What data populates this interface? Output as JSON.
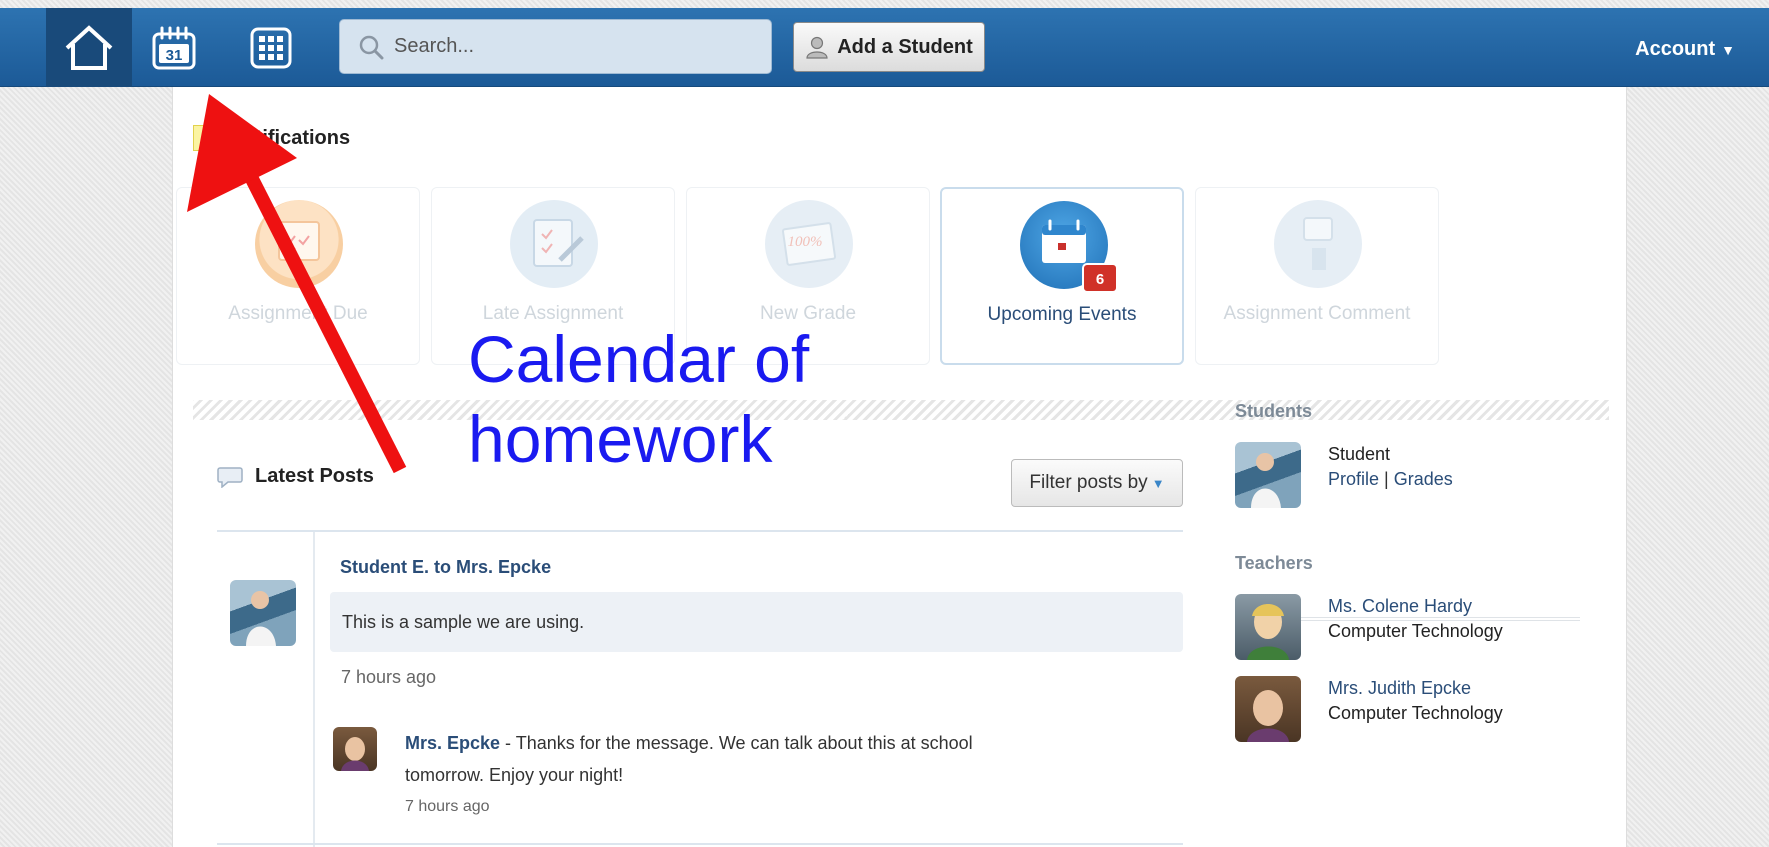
{
  "header": {
    "search_placeholder": "Search...",
    "add_student_label": "Add a Student",
    "account_label": "Account",
    "calendar_day": "31"
  },
  "notifications": {
    "title": "Notifications",
    "cards": [
      {
        "label": "Assignment Due"
      },
      {
        "label": "Late Assignment"
      },
      {
        "label": "New Grade"
      },
      {
        "label": "Upcoming Events",
        "badge": "6"
      },
      {
        "label": "Assignment Comment"
      }
    ]
  },
  "annotation": {
    "line1": "Calendar of",
    "line2": "homework"
  },
  "posts": {
    "title": "Latest Posts",
    "filter_label": "Filter posts by",
    "items": [
      {
        "author": "Student E.",
        "to_word": "to",
        "recipient": "Mrs. Epcke",
        "body": "This is a sample we are using.",
        "time": "7 hours ago",
        "reply": {
          "author": "Mrs. Epcke",
          "text_line1": " - Thanks for the message. We can talk about this at school",
          "text_line2": "tomorrow. Enjoy your night!",
          "time": "7 hours ago"
        }
      }
    ]
  },
  "sidebar": {
    "students_title": "Students",
    "students": [
      {
        "name": "Student",
        "link_profile": "Profile",
        "separator": "|",
        "link_grades": "Grades"
      }
    ],
    "teachers_title": "Teachers",
    "teachers": [
      {
        "name": "Ms. Colene Hardy",
        "subject": "Computer Technology"
      },
      {
        "name": "Mrs. Judith Epcke",
        "subject": "Computer Technology"
      }
    ]
  },
  "colors": {
    "header_blue": "#2468a8",
    "link_blue": "#2a4d78",
    "annotation_red": "#ee1111",
    "annotation_blue": "#1a1af0",
    "badge_red": "#d03128"
  }
}
